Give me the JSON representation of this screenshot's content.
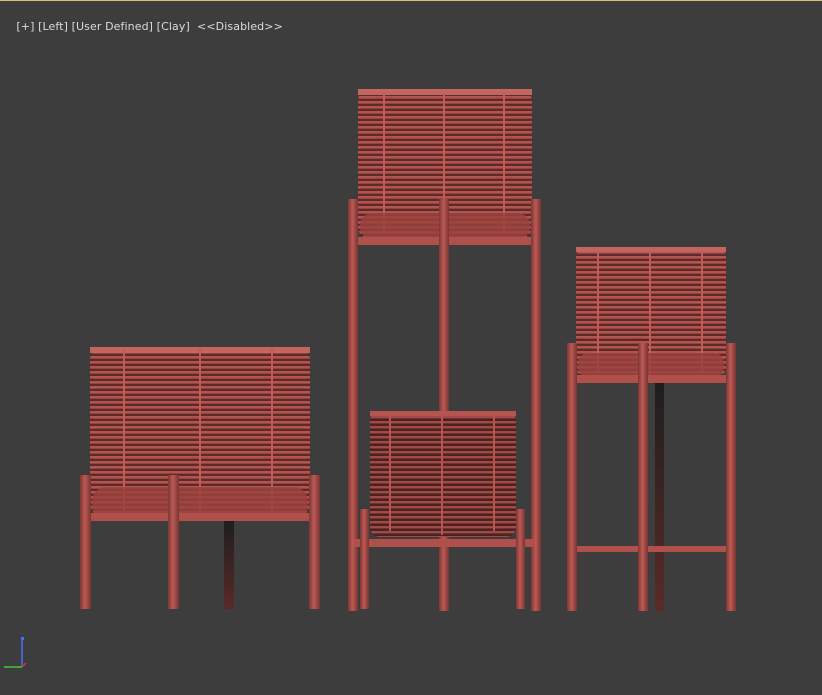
{
  "viewport": {
    "label_plus": "[+]",
    "label_view": "[Left]",
    "label_camera": "[User Defined]",
    "label_shading": "[Clay]",
    "label_status": "<<Disabled>>"
  },
  "scene": {
    "object_color": "#b2524d",
    "rod_color": "#a84a46",
    "background_color": "#3d3d3d"
  },
  "axis_gizmo": {
    "x_color": "#c83c3c",
    "y_color": "#3cc83c",
    "z_color": "#4c6cff"
  }
}
